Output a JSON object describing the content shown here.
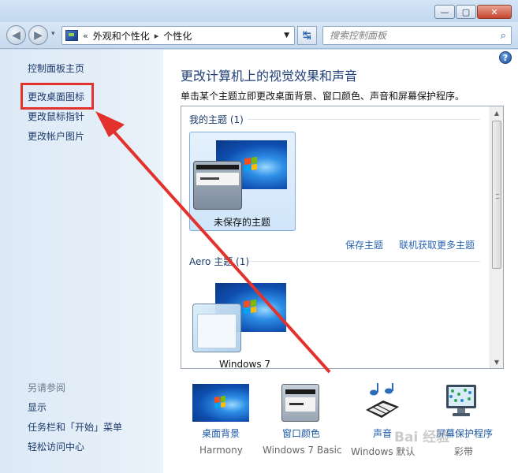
{
  "window": {
    "minimize_glyph": "—",
    "maximize_glyph": "▢",
    "close_glyph": "✕"
  },
  "nav": {
    "back_glyph": "◀",
    "forward_glyph": "▶",
    "history_glyph": "▾",
    "breadcrumb": {
      "overflow": "«",
      "items": [
        "外观和个性化",
        "个性化"
      ],
      "separator": "▸"
    },
    "refresh_glyph": "↹",
    "search_placeholder": "搜索控制面板",
    "search_icon_glyph": "⌕"
  },
  "sidebar": {
    "links": [
      "控制面板主页",
      "更改桌面图标",
      "更改鼠标指针",
      "更改帐户图片"
    ],
    "see_also_heading": "另请参阅",
    "see_also": [
      "显示",
      "任务栏和「开始」菜单",
      "轻松访问中心"
    ]
  },
  "main": {
    "help_glyph": "?",
    "heading": "更改计算机上的视觉效果和声音",
    "subtext": "单击某个主题立即更改桌面背景、窗口颜色、声音和屏幕保护程序。",
    "my_themes": {
      "title": "我的主题 (1)",
      "items": [
        {
          "label": "未保存的主题",
          "selected": true
        }
      ]
    },
    "links": {
      "save_theme": "保存主题",
      "get_more": "联机获取更多主题"
    },
    "aero_themes": {
      "title": "Aero 主题 (1)",
      "items": [
        {
          "label": "Windows 7"
        }
      ]
    },
    "scroll_up_glyph": "▲",
    "scroll_down_glyph": "▼"
  },
  "bottom": {
    "items": [
      {
        "label": "桌面背景",
        "sub": "Harmony"
      },
      {
        "label": "窗口颜色",
        "sub": "Windows 7 Basic"
      },
      {
        "label": "声音",
        "sub": "Windows 默认"
      },
      {
        "label": "屏幕保护程序",
        "sub": "彩带"
      }
    ]
  },
  "watermark": "Bai 经验",
  "colors": {
    "accent_link": "#1b57a6",
    "annotation": "#e3322d",
    "heading": "#1f3f7a"
  }
}
